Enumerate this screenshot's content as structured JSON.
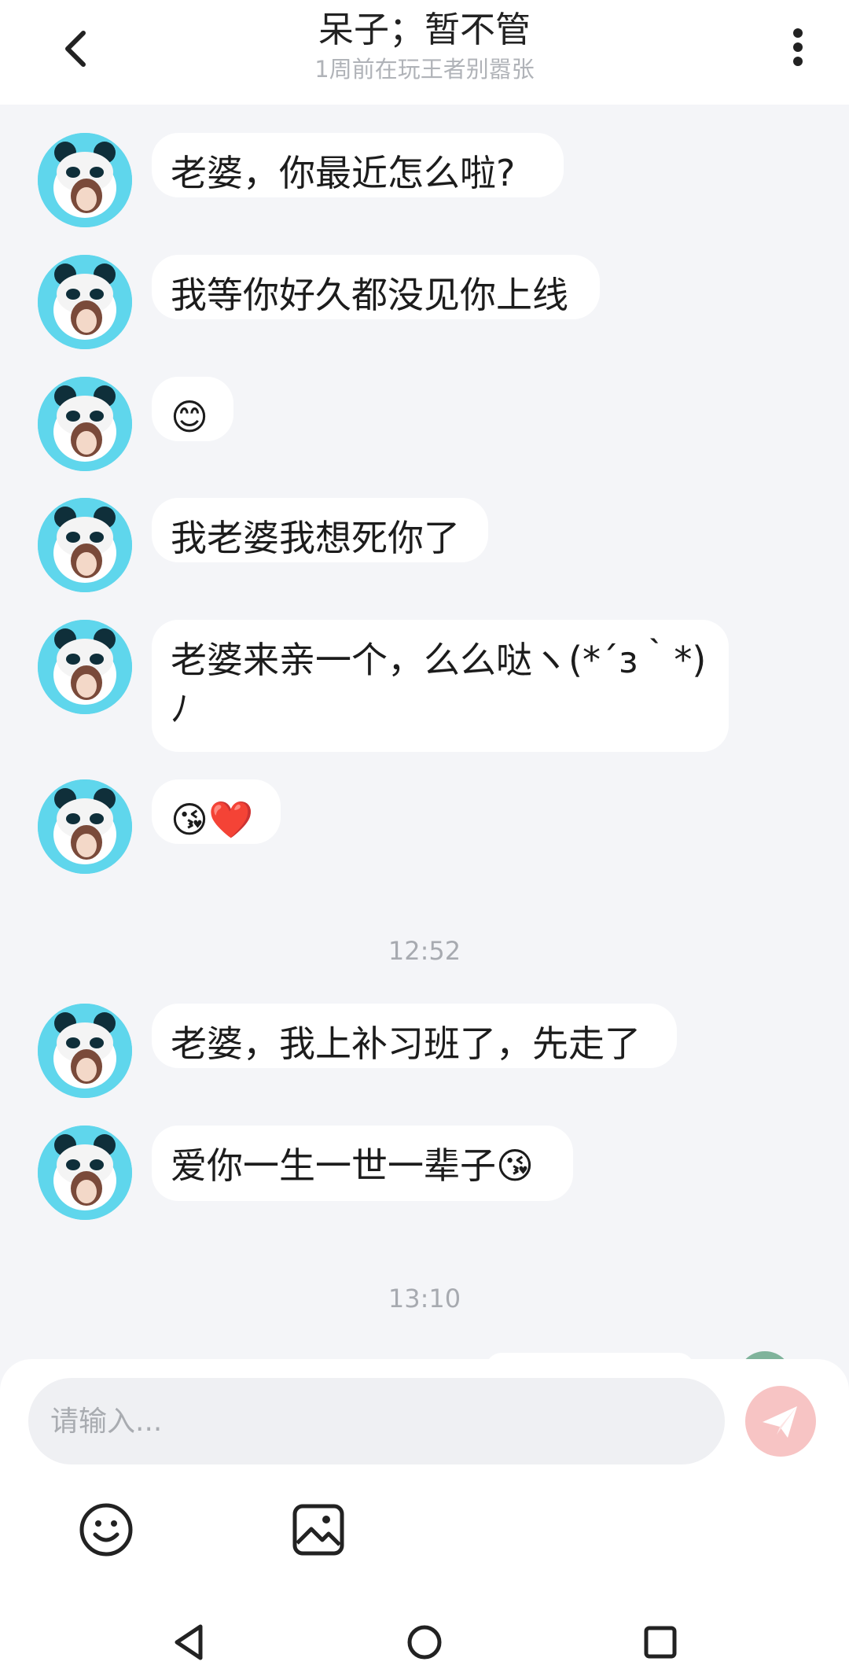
{
  "header": {
    "title": "呆子；暂不管",
    "subtitle": "1周前在玩王者别嚣张"
  },
  "messages": [
    {
      "text": "老婆，你最近怎么啦?"
    },
    {
      "text": "我等你好久都没见你上线"
    },
    {
      "text": "😊"
    },
    {
      "text": "我老婆我想死你了"
    },
    {
      "text": "老婆来亲一个，么么哒ヽ(*´з｀*)ﾉ"
    },
    {
      "text": "😘❤️"
    },
    {
      "text": "老婆，我上补习班了，先走了"
    },
    {
      "text": "爱你一生一世一辈子😘"
    }
  ],
  "timestamps": [
    "12:52",
    "13:10"
  ],
  "input": {
    "placeholder": "请输入..."
  },
  "icons": {
    "back": "back-chevron-icon",
    "more": "more-vertical-icon",
    "send": "paper-plane-icon",
    "emoji": "smiley-icon",
    "image": "image-icon",
    "nav_back": "triangle-back-icon",
    "nav_home": "circle-home-icon",
    "nav_recents": "square-recents-icon"
  },
  "colors": {
    "background": "#f4f5f8",
    "bubble": "#ffffff",
    "send_button": "#f7c4c4",
    "avatar": "#5fd6ec"
  }
}
